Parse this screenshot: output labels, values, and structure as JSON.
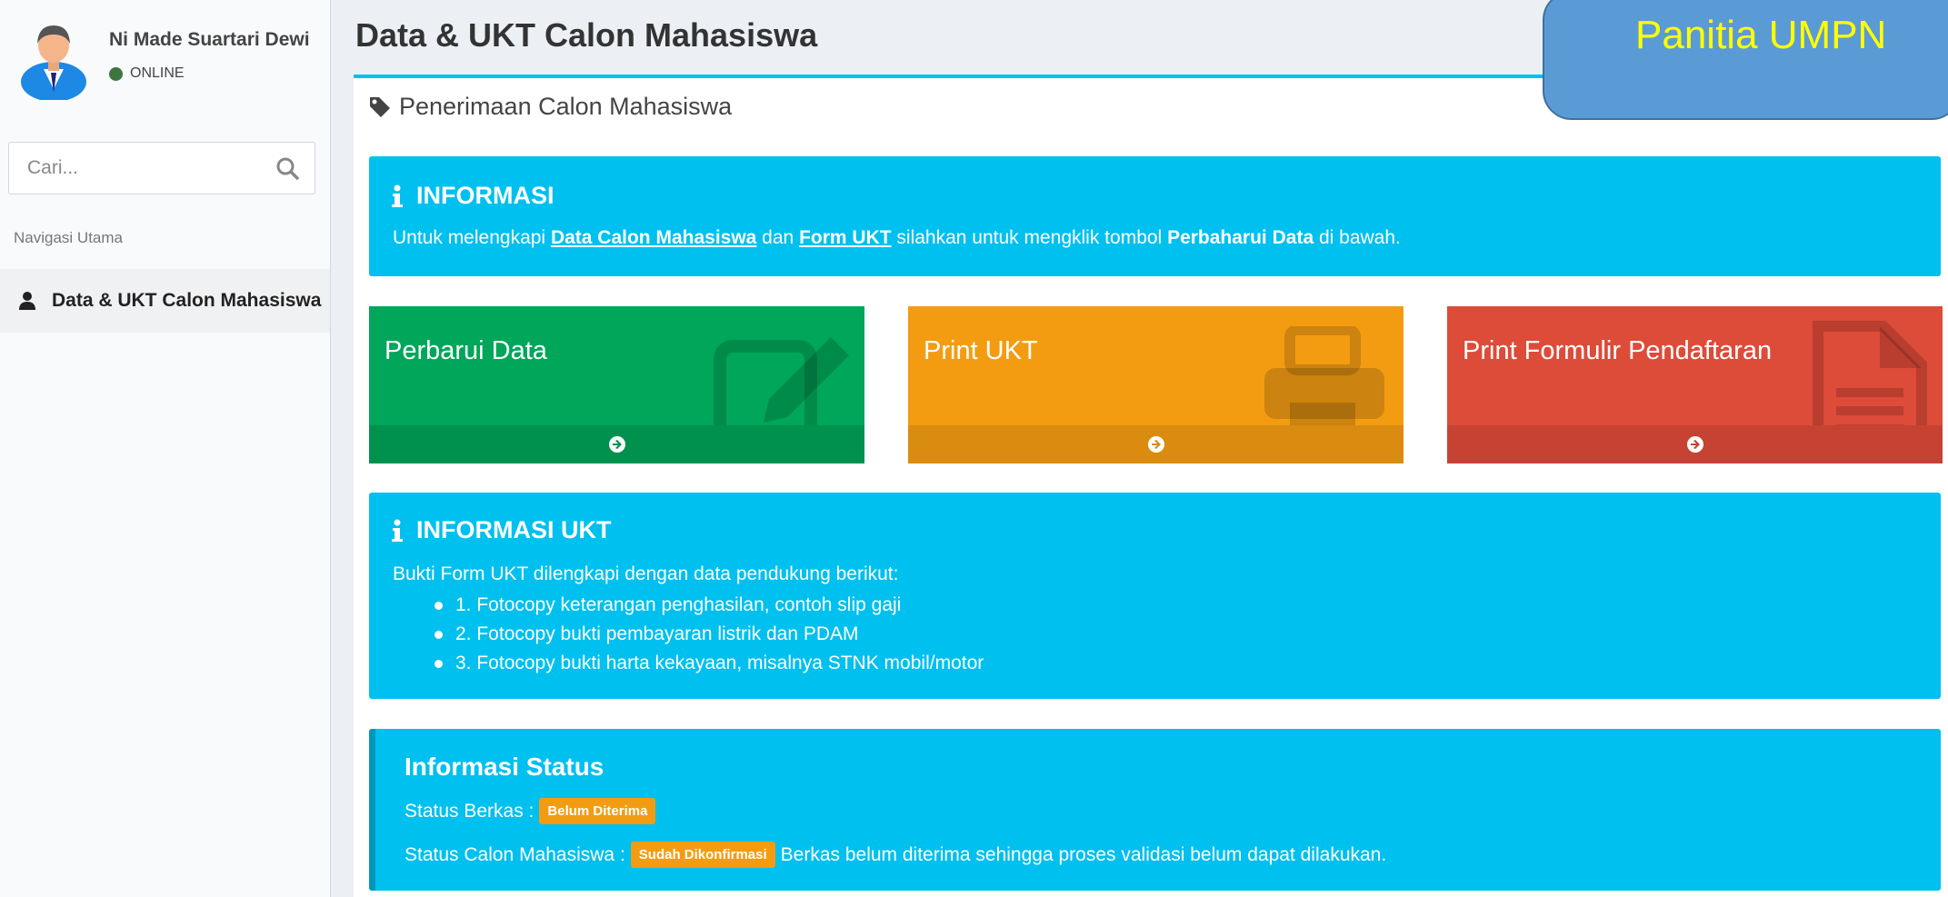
{
  "sidebar": {
    "user": {
      "name": "Ni Made Suartari Dewi",
      "status": "ONLINE"
    },
    "search": {
      "placeholder": "Cari..."
    },
    "nav_header": "Navigasi Utama",
    "nav_items": [
      {
        "label": "Data & UKT Calon Mahasiswa"
      }
    ]
  },
  "header": {
    "title": "Data & UKT Calon Mahasiswa"
  },
  "box": {
    "title": "Penerimaan Calon Mahasiswa"
  },
  "info": {
    "heading": "INFORMASI",
    "text_pre": "Untuk melengkapi ",
    "link_data": "Data Calon Mahasiswa",
    "text_and": " dan ",
    "link_ukt": "Form UKT",
    "text_mid": " silahkan untuk mengklik tombol ",
    "bold_button": "Perbaharui Data",
    "text_post": " di bawah."
  },
  "tiles": [
    {
      "label": "Perbarui Data",
      "icon": "edit-icon"
    },
    {
      "label": "Print UKT",
      "icon": "print-icon"
    },
    {
      "label": "Print Formulir Pendaftaran",
      "icon": "file-text-icon"
    }
  ],
  "info_ukt": {
    "heading": "INFORMASI UKT",
    "intro": "Bukti Form UKT dilengkapi dengan data pendukung berikut:",
    "items": [
      "1. Fotocopy keterangan penghasilan, contoh slip gaji",
      "2. Fotocopy bukti pembayaran listrik dan PDAM",
      "3. Fotocopy bukti harta kekayaan, misalnya STNK mobil/motor"
    ]
  },
  "status": {
    "heading": "Informasi Status",
    "berkas_label": "Status Berkas :",
    "berkas_badge": "Belum Diterima",
    "calon_label": "Status Calon Mahasiswa :",
    "calon_badge": "Sudah Dikonfirmasi",
    "calon_note": "Berkas belum diterima sehingga proses validasi belum dapat dilakukan."
  },
  "overlay": {
    "text": "Panitia UMPN"
  },
  "colors": {
    "aqua": "#00c0ef",
    "green": "#00a65a",
    "orange": "#f39c12",
    "red": "#dd4b39",
    "overlay_bg": "#5b9bd5",
    "overlay_text": "#ffff00"
  }
}
